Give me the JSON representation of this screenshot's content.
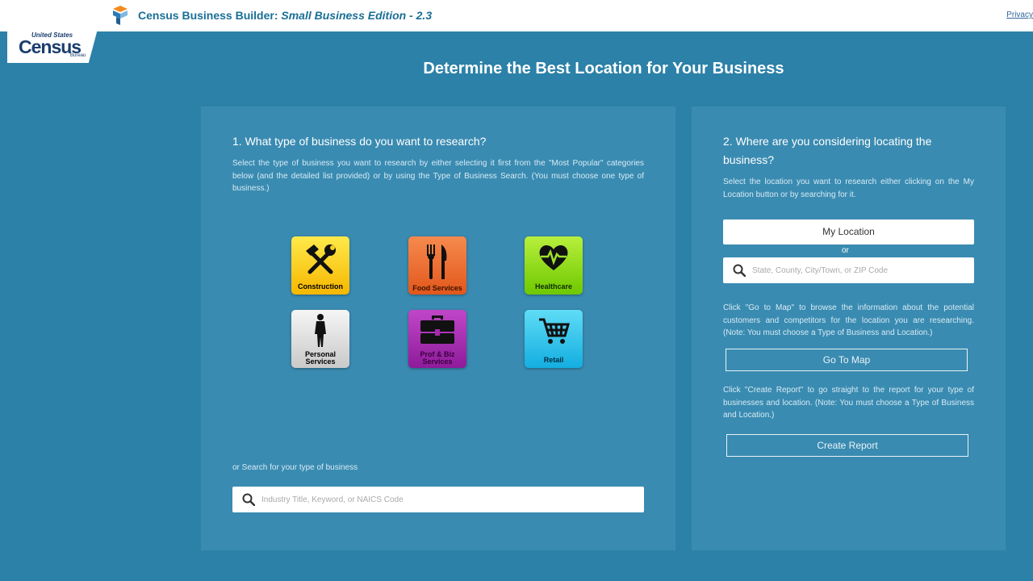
{
  "header": {
    "title_main": "Census Business Builder: ",
    "title_italic": "Small Business Edition - 2.3",
    "privacy_link": "Privacy"
  },
  "badge": {
    "line1": "United States",
    "line2": "Census",
    "line3": "Bureau"
  },
  "page_title": "Determine the Best Location for Your Business",
  "step1": {
    "heading": "1. What type of business do you want to research?",
    "description": "Select the type of business you want to research by either selecting it first from the \"Most Popular\" categories below (and the detailed list provided) or by using the Type of Business Search. (You must choose one type of business.)",
    "categories": [
      {
        "label": "Construction",
        "icon": "tools-icon",
        "color": "#f6c400"
      },
      {
        "label": "Food Services",
        "icon": "fork-knife-icon",
        "color": "#e8652b"
      },
      {
        "label": "Healthcare",
        "icon": "heart-pulse-icon",
        "color": "#8dd51a"
      },
      {
        "label": "Personal Services",
        "icon": "person-icon",
        "color": "#dcdcdc"
      },
      {
        "label": "Prof & Biz Services",
        "icon": "briefcase-icon",
        "color": "#a32aae"
      },
      {
        "label": "Retail",
        "icon": "cart-icon",
        "color": "#2ec3ea"
      }
    ],
    "search_label": "or Search for your type of business",
    "search_placeholder": "Industry Title, Keyword, or NAICS Code"
  },
  "step2": {
    "heading": "2. Where are you considering locating the business?",
    "description": "Select the location you want to research either clicking on the My Location button or by searching for it.",
    "my_location_button": "My Location",
    "or_text": "or",
    "location_placeholder": "State, County, City/Town, or ZIP Code",
    "map_description": "Click \"Go to Map\" to browse the information about the potential customers and competitors for the location you are researching. (Note: You must choose a Type of Business and Location.)",
    "go_to_map_button": "Go To Map",
    "report_description": "Click \"Create Report\" to go straight to the report for your type of businesses and location. (Note: You must choose a Type of Business and Location.)",
    "create_report_button": "Create Report"
  },
  "colors": {
    "background": "#2c81a8",
    "panel": "#3a8bb1",
    "title_blue": "#1a6f96"
  }
}
